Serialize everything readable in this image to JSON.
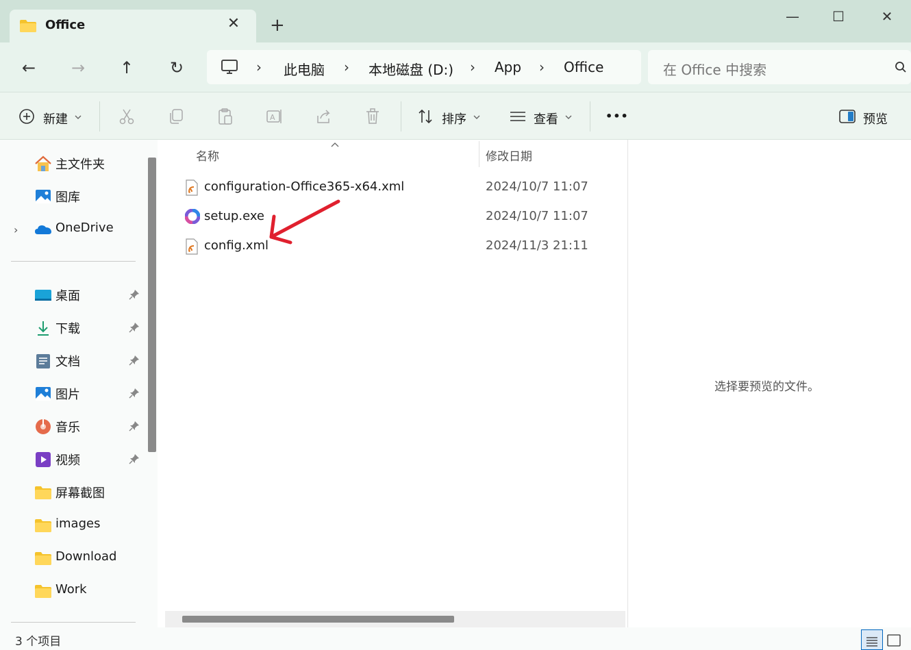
{
  "window": {
    "tab_title": "Office",
    "tab_close_glyph": "✕",
    "new_tab_glyph": "+",
    "minimize_glyph": "—",
    "maximize_glyph": "☐",
    "close_glyph": "✕"
  },
  "nav": {
    "back_glyph": "←",
    "forward_glyph": "→",
    "up_glyph": "↑",
    "refresh_glyph": "↻",
    "separator": "›",
    "breadcrumb": [
      "此电脑",
      "本地磁盘 (D:)",
      "App",
      "Office"
    ],
    "search_placeholder": "在 Office 中搜索"
  },
  "toolbar": {
    "new_label": "新建",
    "sort_label": "排序",
    "view_label": "查看",
    "more_glyph": "•••",
    "preview_label": "预览"
  },
  "sidebar": {
    "quick": [
      {
        "label": "主文件夹",
        "icon": "home-icon"
      },
      {
        "label": "图库",
        "icon": "gallery-icon"
      },
      {
        "label": "OneDrive",
        "icon": "onedrive-icon"
      }
    ],
    "pinned": [
      {
        "label": "桌面",
        "icon": "desktop-icon",
        "pinned": true
      },
      {
        "label": "下载",
        "icon": "download-icon",
        "pinned": true
      },
      {
        "label": "文档",
        "icon": "document-icon",
        "pinned": true
      },
      {
        "label": "图片",
        "icon": "pictures-icon",
        "pinned": true
      },
      {
        "label": "音乐",
        "icon": "music-icon",
        "pinned": true
      },
      {
        "label": "视频",
        "icon": "video-icon",
        "pinned": true
      },
      {
        "label": "屏幕截图",
        "icon": "folder-icon",
        "pinned": false
      },
      {
        "label": "images",
        "icon": "folder-icon",
        "pinned": false
      },
      {
        "label": "Download",
        "icon": "folder-icon",
        "pinned": false
      },
      {
        "label": "Work",
        "icon": "folder-icon",
        "pinned": false
      }
    ],
    "pin_glyph": "📌"
  },
  "files": {
    "col_name": "名称",
    "col_date": "修改日期",
    "rows": [
      {
        "name": "configuration-Office365-x64.xml",
        "date": "2024/10/7 11:07",
        "icon": "xml-file-icon"
      },
      {
        "name": "setup.exe",
        "date": "2024/10/7 11:07",
        "icon": "office-setup-icon"
      },
      {
        "name": "config.xml",
        "date": "2024/11/3 21:11",
        "icon": "xml-file-icon"
      }
    ]
  },
  "preview": {
    "empty_text": "选择要预览的文件。"
  },
  "status": {
    "item_count": "3 个项目"
  },
  "colors": {
    "annotation_arrow": "#e0202e",
    "accent": "#0067c0"
  }
}
